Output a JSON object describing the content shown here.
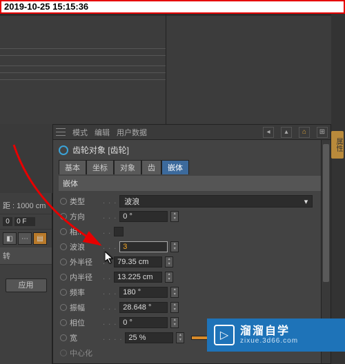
{
  "timestamp": "2019-10-25 15:15:36",
  "side_tab": "属性",
  "left": {
    "dist_label": "距 : 1000 cm",
    "frame": "0",
    "frame_unit": "0 F",
    "section": "转",
    "apply": "应用"
  },
  "menubar": {
    "mode": "模式",
    "edit": "编辑",
    "userdata": "用户数据"
  },
  "object": {
    "title": "齿轮对象 [齿轮]"
  },
  "tabs": {
    "t0": "基本",
    "t1": "坐标",
    "t2": "对象",
    "t3": "齿",
    "t4": "嵌体"
  },
  "section": "嵌体",
  "params": {
    "type_label": "类型",
    "type_value": "波浪",
    "dir_label": "方向",
    "dir_value": "0 °",
    "rel_label": "相...",
    "wave_label": "波浪",
    "wave_value": "3",
    "outr_label": "外半径",
    "outr_value": "79.35 cm",
    "inr_label": "内半径",
    "inr_value": "13.225 cm",
    "freq_label": "频率",
    "freq_value": "180 °",
    "amp_label": "振幅",
    "amp_value": "28.648 °",
    "phase_label": "相位",
    "phase_value": "0 °",
    "width_label": "宽",
    "width_value": "25 %",
    "center_label": "中心化"
  },
  "watermark": {
    "title": "溜溜自学",
    "url": "zixue.3d66.com"
  }
}
